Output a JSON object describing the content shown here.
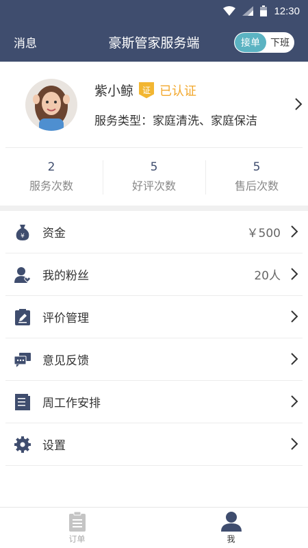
{
  "status_bar": {
    "time": "12:30"
  },
  "header": {
    "messages_label": "消息",
    "title": "豪斯管家服务端",
    "toggle_on_label": "接单",
    "toggle_off_label": "下班"
  },
  "profile": {
    "name": "紫小鲸",
    "badge_text": "证",
    "verified_label": "已认证",
    "service_type": "服务类型：家庭清洗、家庭保洁"
  },
  "stats": [
    {
      "value": "2",
      "label": "服务次数"
    },
    {
      "value": "5",
      "label": "好评次数"
    },
    {
      "value": "5",
      "label": "售后次数"
    }
  ],
  "menu": [
    {
      "label": "资金",
      "value": "￥500",
      "icon": "money-bag-icon"
    },
    {
      "label": "我的粉丝",
      "value": "20人",
      "icon": "user-heart-icon"
    },
    {
      "label": "评价管理",
      "value": "",
      "icon": "clipboard-edit-icon"
    },
    {
      "label": "意见反馈",
      "value": "",
      "icon": "chat-bubbles-icon"
    },
    {
      "label": "周工作安排",
      "value": "",
      "icon": "schedule-book-icon"
    },
    {
      "label": "设置",
      "value": "",
      "icon": "gear-icon"
    }
  ],
  "tabbar": {
    "orders_label": "订单",
    "me_label": "我"
  },
  "colors": {
    "header_bg": "#3f4d6e",
    "toggle_accent": "#5bb3c2",
    "verified": "#f2a72b",
    "icon": "#3f4d6e"
  }
}
